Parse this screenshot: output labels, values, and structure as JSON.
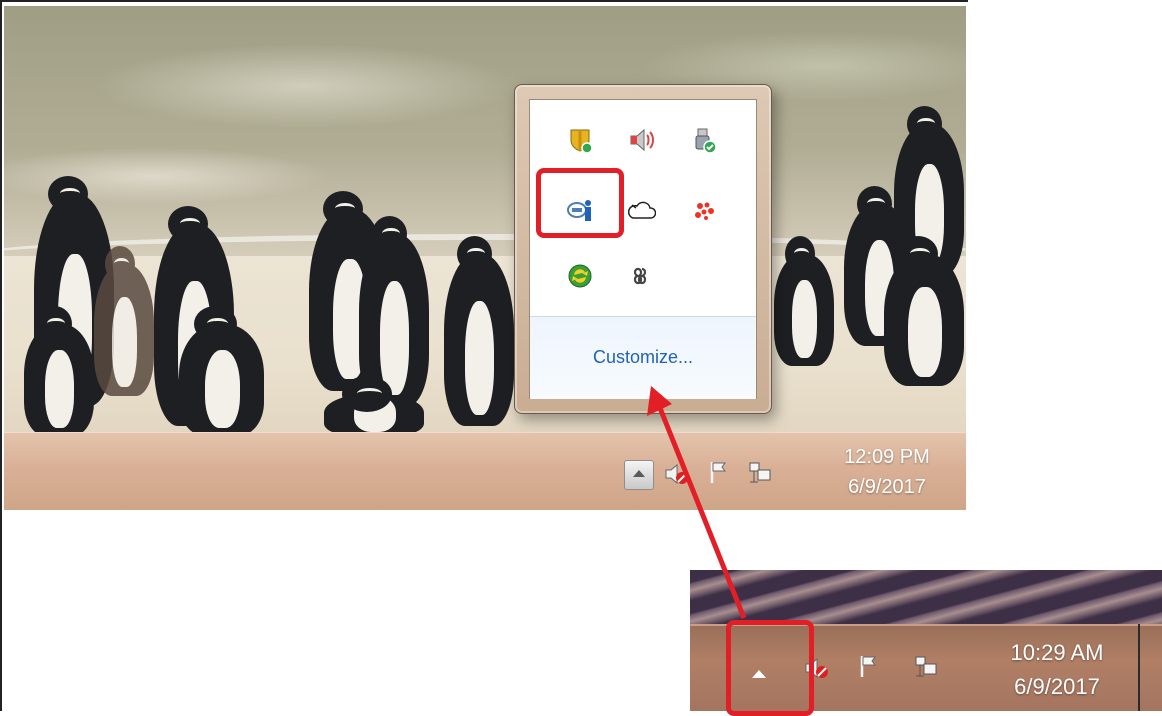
{
  "top_screenshot": {
    "clock": {
      "time": "12:09 PM",
      "date": "6/9/2017"
    },
    "tray_flyout": {
      "icons": [
        {
          "name": "security-shield-icon"
        },
        {
          "name": "speaker-icon"
        },
        {
          "name": "usb-safely-remove-icon"
        },
        {
          "name": "network-connection-icon"
        },
        {
          "name": "cloud-sync-icon"
        },
        {
          "name": "cluster-dots-icon"
        },
        {
          "name": "green-refresh-icon"
        },
        {
          "name": "infinity-link-icon"
        }
      ],
      "customize_label": "Customize..."
    }
  },
  "bottom_screenshot": {
    "clock": {
      "time": "10:29 AM",
      "date": "6/9/2017"
    }
  },
  "colors": {
    "highlight": "#e21f26",
    "link": "#1f63b8"
  }
}
